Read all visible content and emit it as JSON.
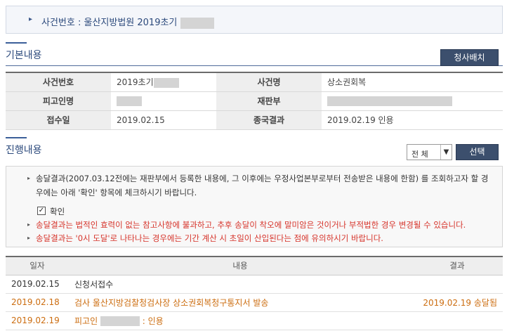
{
  "case_header": {
    "text": "사건번호 : 울산지방법원 2019초기"
  },
  "basic_section": {
    "title": "기본내용",
    "button": "청사배치",
    "rows": [
      {
        "label1": "사건번호",
        "value1": "2019초기",
        "label2": "사건명",
        "value2": "상소권회복"
      },
      {
        "label1": "피고인명",
        "value1": "",
        "label2": "재판부",
        "value2": ""
      },
      {
        "label1": "접수일",
        "value1": "2019.02.15",
        "label2": "종국결과",
        "value2": "2019.02.19 인용"
      }
    ]
  },
  "progress_section": {
    "title": "진행내용",
    "filter_value": "전 체",
    "select_button": "선택",
    "notice": {
      "line1": "송달결과(2007.03.12전에는 재판부에서 등록한 내용에, 그 이후에는 우정사업본부로부터 전송받은 내용에 한함) 를 조회하고자 할 경",
      "line1b": "우에는 아래 '확인' 항목에 체크하시기 바랍니다.",
      "checkbox_label": "확인",
      "line2": "송달결과는 법적인 효력이 없는 참고사항에 불과하고, 추후 송달이 착오에 말미암은 것이거나 부적법한 경우 변경될 수 있습니다.",
      "line3": "송달결과는 '0시 도달'로 나타나는 경우에는 기간 계산 시 초일이 산입된다는 점에 유의하시기 바랍니다."
    },
    "table": {
      "headers": [
        "일자",
        "내용",
        "결과"
      ],
      "rows": [
        {
          "date": "2019.02.15",
          "content": "신청서접수",
          "result": ""
        },
        {
          "date": "2019.02.18",
          "content": "검사 울산지방검찰청검사장 상소권회복청구통지서 발송",
          "result": "2019.02.19 송달됨"
        },
        {
          "date": "2019.02.19",
          "content_prefix": "피고인",
          "content_suffix": ": 인용",
          "result": ""
        }
      ]
    }
  },
  "colors": {
    "title_blue": "#2c4a7c",
    "button_dark": "#3c4f6d",
    "notice_red": "#d6332a",
    "row_orange": "#cc6d10"
  }
}
